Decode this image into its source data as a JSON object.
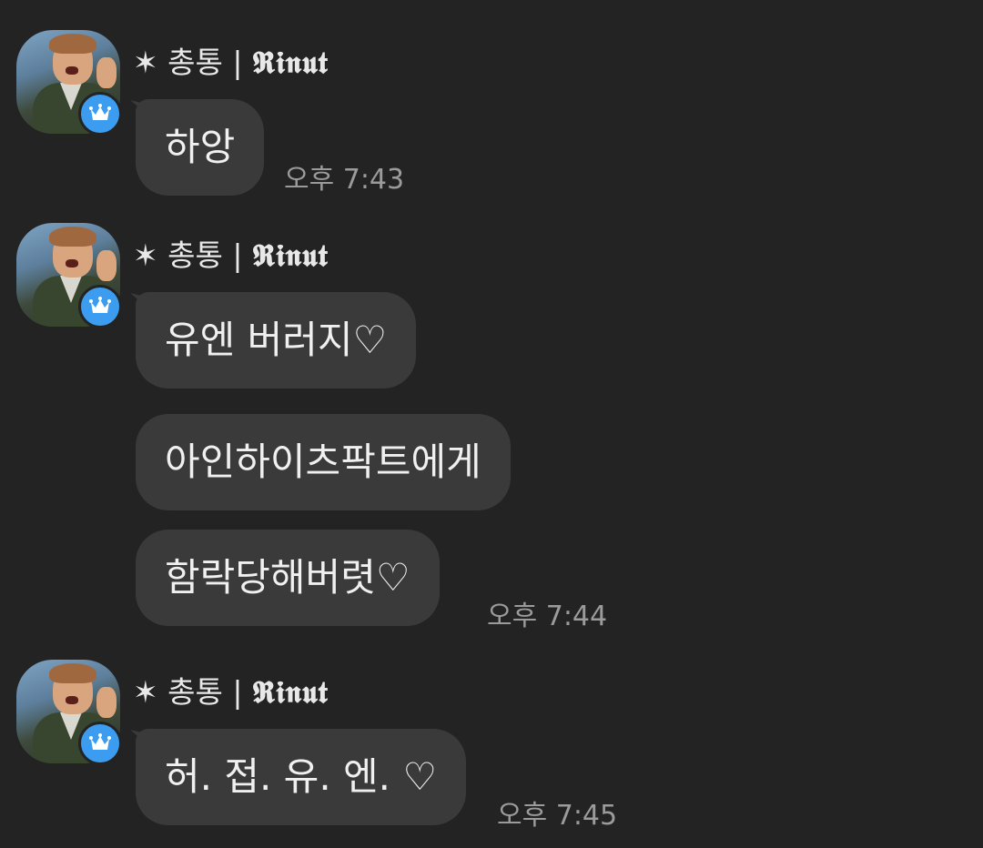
{
  "sender": {
    "name_prefix": "✶ 총통 | ",
    "name_brand": "𝕽𝖎𝖓𝖚𝖙"
  },
  "groups": [
    {
      "messages": [
        "하앙"
      ],
      "time": "오후 7:43"
    },
    {
      "messages": [
        "유엔 버러지♡",
        "아인하이츠팍트에게",
        "함락당해버렷♡"
      ],
      "time": "오후 7:44"
    },
    {
      "messages": [
        "허. 접. 유. 엔. ♡"
      ],
      "time": "오후 7:45"
    }
  ],
  "colors": {
    "background": "#232323",
    "bubble": "#3a3a3a",
    "badge": "#3b9cf0"
  },
  "icons": {
    "badge": "crown-icon"
  }
}
